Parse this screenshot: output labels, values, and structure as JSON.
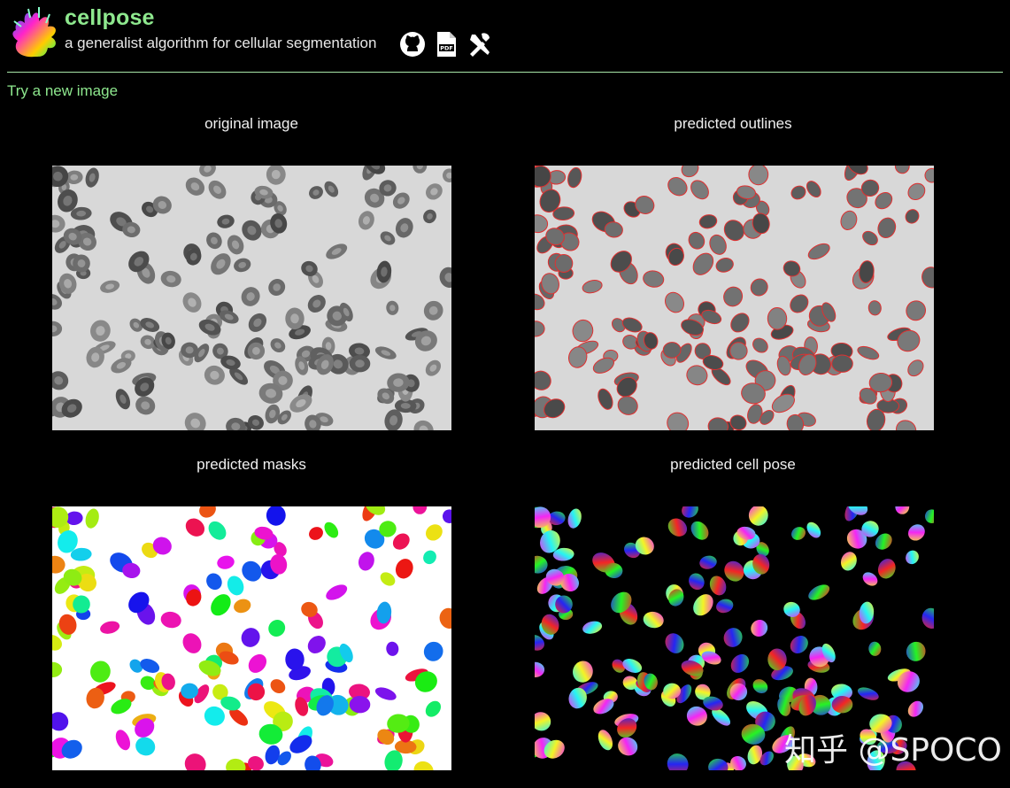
{
  "app": {
    "title": "cellpose",
    "subtitle": "a generalist algorithm for cellular segmentation",
    "icons": [
      "github-icon",
      "pdf-icon",
      "tools-icon"
    ],
    "accent_color": "#8ee88e"
  },
  "actions": {
    "try_new_image": "Try a new image"
  },
  "panels": [
    {
      "title": "original image",
      "image": "grayscale micrograph of red blood cells"
    },
    {
      "title": "predicted outlines",
      "image": "micrograph with red cell outlines"
    },
    {
      "title": "predicted masks",
      "image": "colored cell masks on white"
    },
    {
      "title": "predicted cell pose",
      "image": "flow field hue-colored cells on black"
    }
  ],
  "watermark": {
    "text": "知乎 @SPOCO"
  }
}
